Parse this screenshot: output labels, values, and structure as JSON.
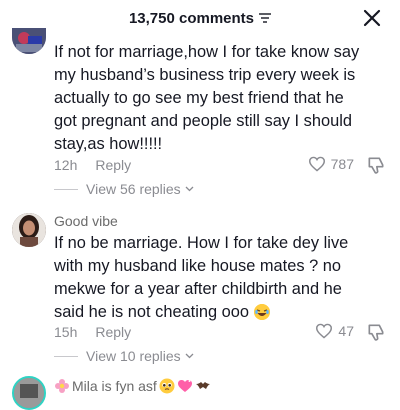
{
  "header": {
    "comments_count": "13,750 comments"
  },
  "comments": [
    {
      "text": "If not for marriage,how I for take know say my husband’s business trip every week is actually to go see my best friend that he got pregnant and people still say I should stay,as how!!!!!",
      "time": "12h",
      "reply_label": "Reply",
      "likes": "787",
      "view_replies": "View 56 replies"
    },
    {
      "username": "Good vibe",
      "text": "If no be marriage. How I for take dey live with my husband like house mates ? no mekwe for a year after childbirth and he said he is not cheating ooo",
      "time": "15h",
      "reply_label": "Reply",
      "likes": "47",
      "view_replies": "View 10 replies"
    },
    {
      "username": "Mila is fyn asf"
    }
  ]
}
